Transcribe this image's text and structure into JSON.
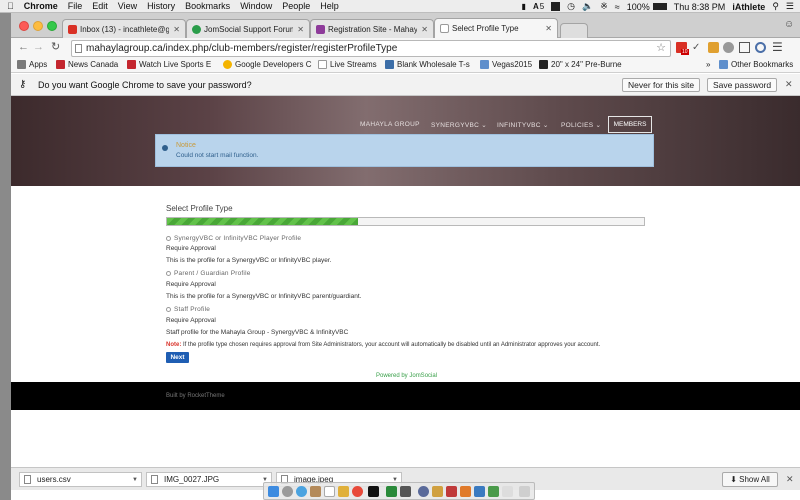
{
  "menubar": {
    "app": "Chrome",
    "items": [
      "File",
      "Edit",
      "View",
      "History",
      "Bookmarks",
      "Window",
      "People",
      "Help"
    ],
    "adobe_count": "5",
    "battery": "100%",
    "clock": "Thu 8:38 PM",
    "user": "iAthlete"
  },
  "tabs": [
    {
      "label": "Inbox (13) - incathlete@gm",
      "favicon_color": "#d93025",
      "active": false
    },
    {
      "label": "JomSocial Support Forum",
      "favicon_color": "#2a9d4a",
      "active": false
    },
    {
      "label": "Registration Site - Mahayla",
      "favicon_color": "#8e3b9a",
      "active": false
    },
    {
      "label": "Select Profile Type",
      "favicon_color": "#cccccc",
      "active": true
    }
  ],
  "address": {
    "url": "mahaylagroup.ca/index.php/club-members/register/registerProfileType"
  },
  "toolbar": {
    "gmail_badge": "10"
  },
  "bookmarks": [
    {
      "label": "Apps",
      "color": "#7a7a7a"
    },
    {
      "label": "News Canada",
      "color": "#c4262e"
    },
    {
      "label": "Watch Live Sports E",
      "color": "#c4262e"
    },
    {
      "label": "Google Developers C",
      "color": "#f4b400"
    },
    {
      "label": "Live Streams",
      "color": "#dddddd"
    },
    {
      "label": "Blank Wholesale T-s",
      "color": "#3c6ea8"
    },
    {
      "label": "Vegas2015",
      "color": "#5f8fcc"
    },
    {
      "label": "20\" x 24\" Pre-Burne",
      "color": "#222222"
    }
  ],
  "bookmarks_overflow": "»",
  "other_bookmarks": "Other Bookmarks",
  "password_bar": {
    "prompt": "Do you want Google Chrome to save your password?",
    "never_label": "Never for this site",
    "save_label": "Save password"
  },
  "nav": {
    "items": [
      "MAHAYLA GROUP",
      "SYNERGYVBC",
      "INFINITYVBC",
      "POLICIES"
    ],
    "dropdown_marker": "⌄",
    "members": "MEMBERS"
  },
  "notice": {
    "title": "Notice",
    "message": "Could not start mail function."
  },
  "form": {
    "heading": "Select Profile Type",
    "progress_fraction": 0.4,
    "profiles": [
      {
        "name": "SynergyVBC or InfinityVBC Player Profile",
        "approval": "Require Approval",
        "description": "This is the profile for a SynergyVBC or InfinityVBC player."
      },
      {
        "name": "Parent / Guardian Profile",
        "approval": "Require Approval",
        "description": "This is the profile for a SynergyVBC or InfinityVBC parent/guardiant."
      },
      {
        "name": "Staff Profile",
        "approval": "Require Approval",
        "description": "Staff profile for the Mahayla Group - SynergyVBC & InfinityVBC"
      }
    ],
    "note_label": "Note:",
    "note_text": " If the profile type chosen requires approval from Site Administrators, your account will automatically be disabled until an Administrator approves your account.",
    "next_label": "Next",
    "powered_by": "Powered by JomSocial"
  },
  "footer": {
    "text": "Built by RocketTheme"
  },
  "downloads": {
    "files": [
      "users.csv",
      "IMG_0027.JPG",
      "image.jpeg"
    ],
    "show_all": "Show All"
  },
  "colors": {
    "link_green": "#3aa04a",
    "note_red": "#d9342b",
    "button_blue": "#1f5eb3",
    "notice_bg": "#b9d4ec"
  }
}
